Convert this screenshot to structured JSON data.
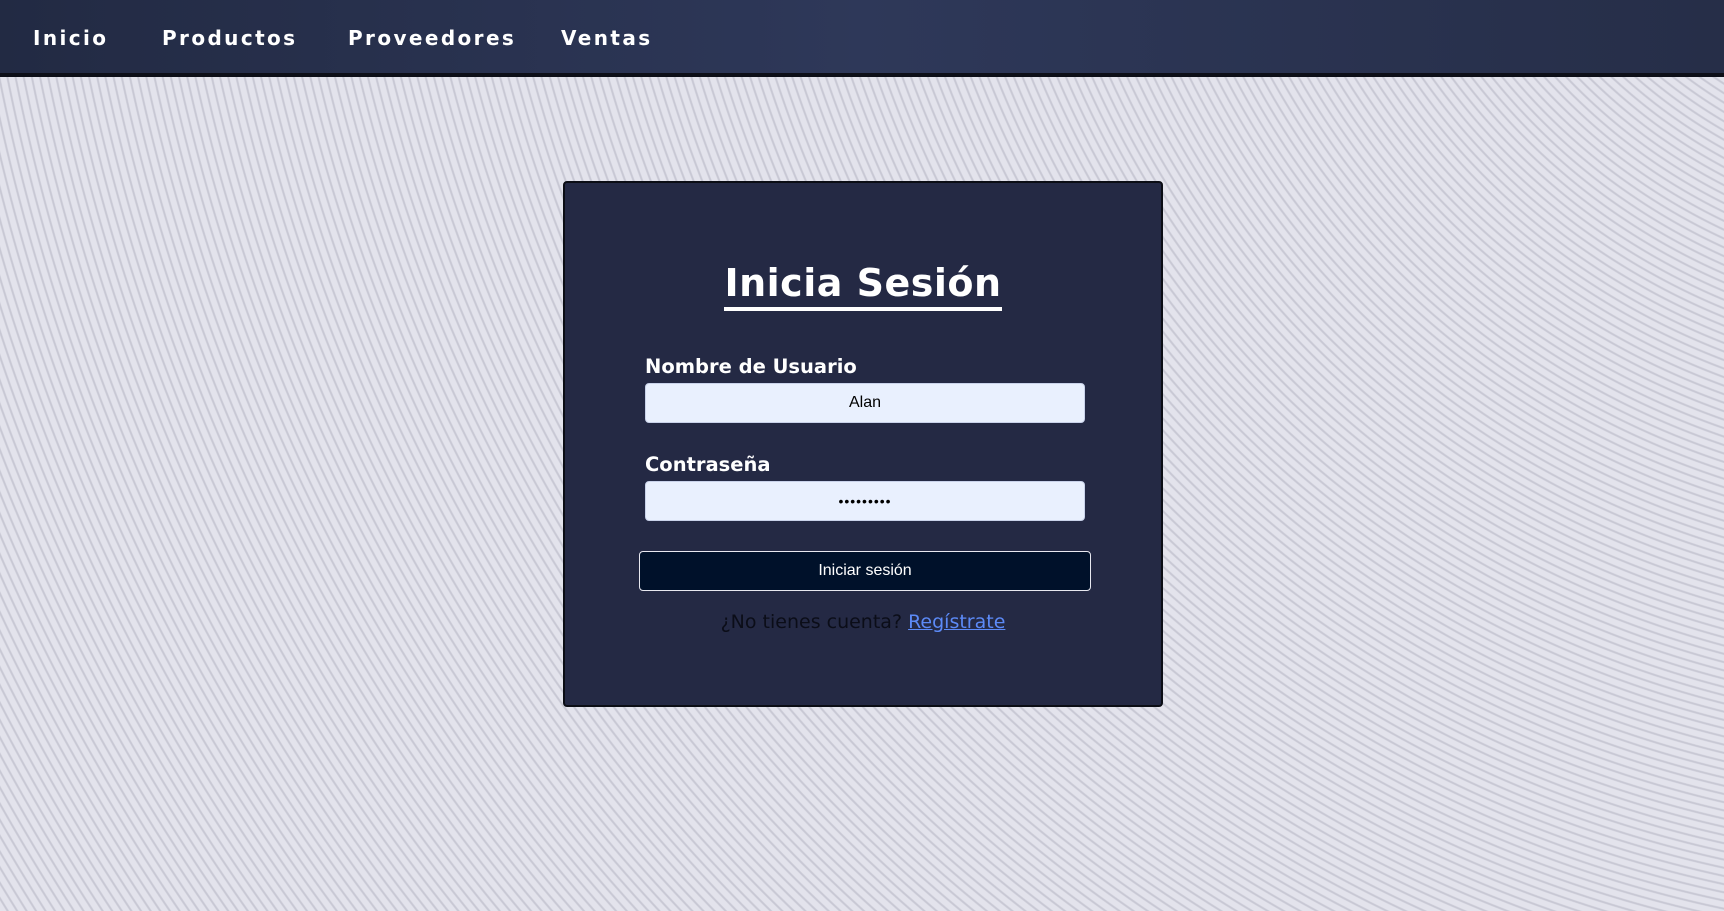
{
  "nav": {
    "items": [
      {
        "label": "Inicio"
      },
      {
        "label": "Productos"
      },
      {
        "label": "Proveedores"
      },
      {
        "label": "Ventas"
      }
    ]
  },
  "login": {
    "title": "Inicia Sesión",
    "username_label": "Nombre de Usuario",
    "username_value": "Alan",
    "password_label": "Contraseña",
    "password_value": "•••••••••",
    "submit_label": "Iniciar sesión",
    "register_prompt": "¿No tienes cuenta?",
    "register_link": "Regístrate"
  },
  "colors": {
    "navbar": "#2e3859",
    "card": "#242944",
    "input_bg": "#e9f0fe",
    "button_bg": "#00112a",
    "link": "#5c8af7"
  }
}
